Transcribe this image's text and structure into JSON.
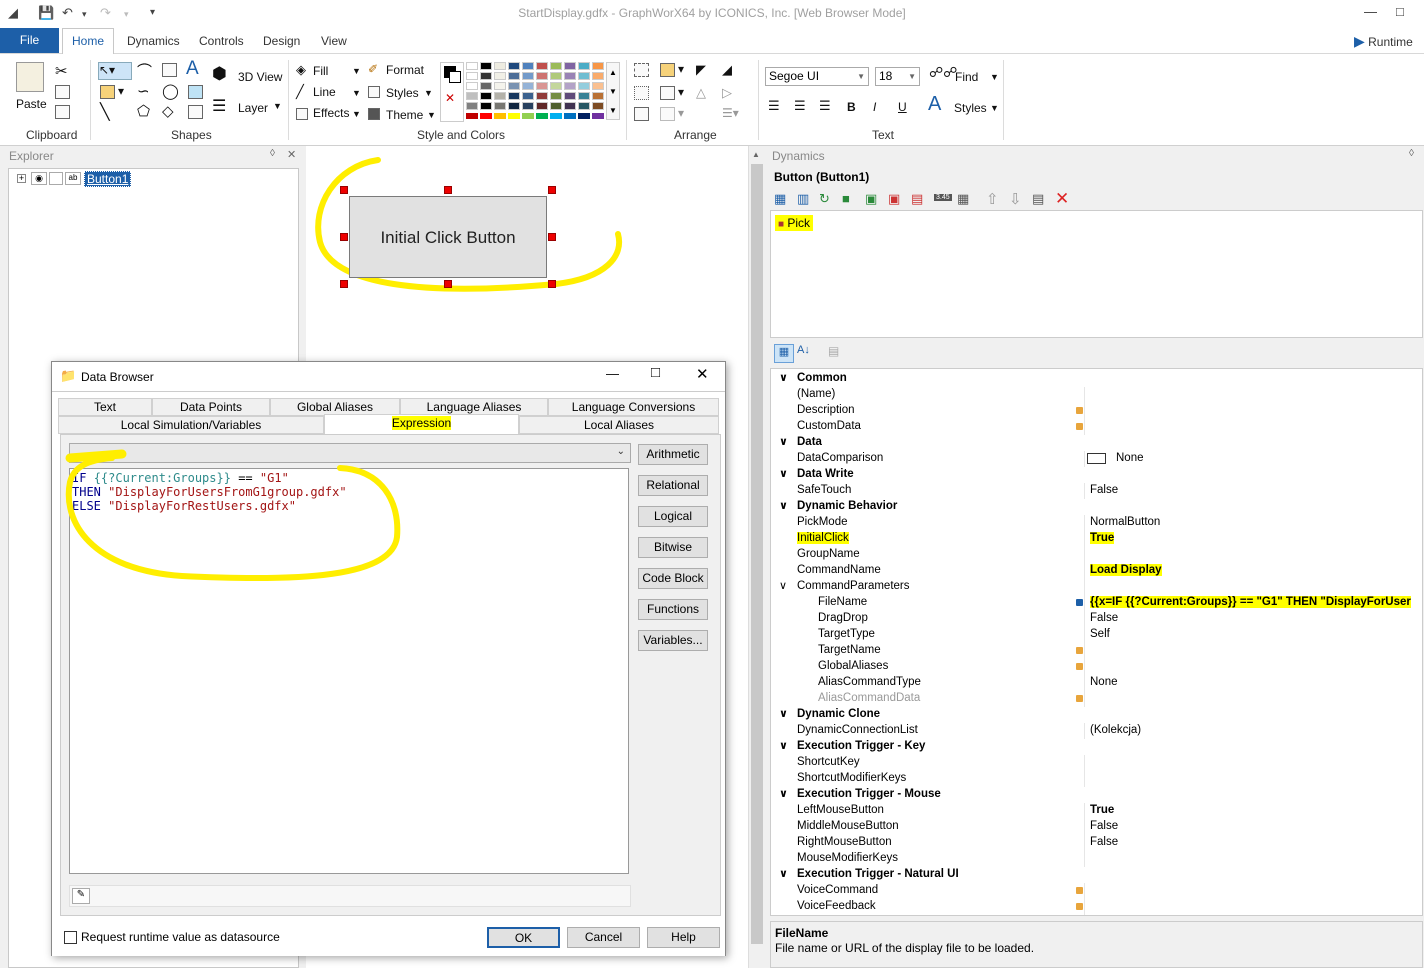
{
  "window": {
    "title": "StartDisplay.gdfx - GraphWorX64 by ICONICS, Inc. [Web Browser Mode]"
  },
  "menu": {
    "file": "File",
    "tabs": [
      "Home",
      "Dynamics",
      "Controls",
      "Design",
      "View"
    ],
    "runtime": "Runtime"
  },
  "ribbon": {
    "paste": "Paste",
    "groups": [
      "Clipboard",
      "Shapes",
      "Style and Colors",
      "Arrange",
      "Text"
    ],
    "view3d": "3D View",
    "layer": "Layer",
    "fill": "Fill",
    "line": "Line",
    "effects": "Effects",
    "format": "Format",
    "styles": "Styles",
    "theme": "Theme",
    "font": "Segoe UI",
    "fontsize": "18",
    "find": "Find",
    "text_styles": "Styles",
    "bold": "B",
    "italic": "I",
    "underline": "U"
  },
  "explorer": {
    "title": "Explorer",
    "item": "Button1"
  },
  "canvas": {
    "button_label": "Initial Click Button"
  },
  "dialog": {
    "title": "Data Browser",
    "tabs_row1": [
      "Text",
      "Data Points",
      "Global Aliases",
      "Language Aliases",
      "Language Conversions"
    ],
    "tabs_row2": [
      "Local Simulation/Variables",
      "Expression",
      "Local Aliases"
    ],
    "expression": {
      "line1_kw": "IF",
      "line1_tag": "{{?Current:Groups}}",
      "line1_op": "==",
      "line1_str": "\"G1\"",
      "line2_kw": "THEN",
      "line2_str": "\"DisplayForUsersFromG1group.gdfx\"",
      "line3_kw": "ELSE",
      "line3_str": "\"DisplayForRestUsers.gdfx\""
    },
    "side_buttons": [
      "Arithmetic",
      "Relational",
      "Logical",
      "Bitwise",
      "Code Block",
      "Functions",
      "Variables..."
    ],
    "checkbox": "Request runtime value as datasource",
    "ok": "OK",
    "cancel": "Cancel",
    "help": "Help"
  },
  "dynamics": {
    "title": "Dynamics",
    "object": "Button (Button1)",
    "pick": "Pick",
    "properties": [
      {
        "type": "cat",
        "name": "Common"
      },
      {
        "type": "prop",
        "name": "(Name)",
        "value": ""
      },
      {
        "type": "prop",
        "name": "Description",
        "value": "",
        "dot": true
      },
      {
        "type": "prop",
        "name": "CustomData",
        "value": "",
        "dot": true
      },
      {
        "type": "cat",
        "name": "Data"
      },
      {
        "type": "prop",
        "name": "DataComparison",
        "value": "None",
        "box": true
      },
      {
        "type": "cat",
        "name": "Data Write"
      },
      {
        "type": "prop",
        "name": "SafeTouch",
        "value": "False"
      },
      {
        "type": "cat",
        "name": "Dynamic Behavior"
      },
      {
        "type": "prop",
        "name": "PickMode",
        "value": "NormalButton"
      },
      {
        "type": "prop",
        "name": "InitialClick",
        "value": "True",
        "hl": true,
        "bold": true
      },
      {
        "type": "prop",
        "name": "GroupName",
        "value": ""
      },
      {
        "type": "prop",
        "name": "CommandName",
        "value": "Load Display",
        "hlv": true,
        "bold": true
      },
      {
        "type": "sub",
        "name": "CommandParameters",
        "value": ""
      },
      {
        "type": "prop2",
        "name": "FileName",
        "value": "{{x=IF {{?Current:Groups}} == \"G1\" THEN \"DisplayForUser",
        "hlv": true,
        "bold": true,
        "dot": true,
        "blue": true
      },
      {
        "type": "prop2",
        "name": "DragDrop",
        "value": "False"
      },
      {
        "type": "prop2",
        "name": "TargetType",
        "value": "Self"
      },
      {
        "type": "prop2",
        "name": "TargetName",
        "value": "",
        "dot": true
      },
      {
        "type": "prop2",
        "name": "GlobalAliases",
        "value": "",
        "dot": true
      },
      {
        "type": "prop2",
        "name": "AliasCommandType",
        "value": "None"
      },
      {
        "type": "prop2",
        "name": "AliasCommandData",
        "value": "",
        "dot": true,
        "grey": true
      },
      {
        "type": "cat",
        "name": "Dynamic Clone"
      },
      {
        "type": "prop",
        "name": "DynamicConnectionList",
        "value": "(Kolekcja)"
      },
      {
        "type": "cat",
        "name": "Execution Trigger - Key"
      },
      {
        "type": "prop",
        "name": "ShortcutKey",
        "value": ""
      },
      {
        "type": "prop",
        "name": "ShortcutModifierKeys",
        "value": ""
      },
      {
        "type": "cat",
        "name": "Execution Trigger - Mouse"
      },
      {
        "type": "prop",
        "name": "LeftMouseButton",
        "value": "True",
        "bold": true
      },
      {
        "type": "prop",
        "name": "MiddleMouseButton",
        "value": "False"
      },
      {
        "type": "prop",
        "name": "RightMouseButton",
        "value": "False"
      },
      {
        "type": "prop",
        "name": "MouseModifierKeys",
        "value": ""
      },
      {
        "type": "cat",
        "name": "Execution Trigger - Natural UI"
      },
      {
        "type": "prop",
        "name": "VoiceCommand",
        "value": "",
        "dot": true
      },
      {
        "type": "prop",
        "name": "VoiceFeedback",
        "value": "",
        "dot": true
      }
    ],
    "help_title": "FileName",
    "help_text": "File name or URL of the display file to be loaded."
  },
  "colors": {
    "accent": "#1d5fa8",
    "highlight": "#ffff00",
    "handle": "#e00000"
  }
}
